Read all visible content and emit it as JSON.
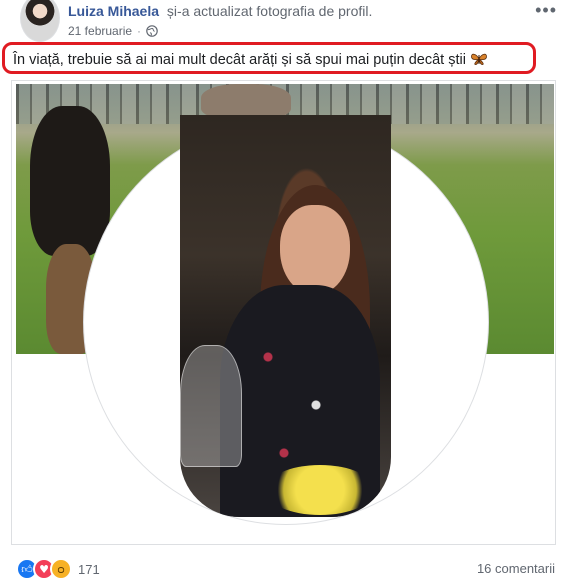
{
  "post": {
    "author": "Luiza Mihaela",
    "action": "și-a actualizat fotografia de profil.",
    "date": "21 februarie",
    "separator": "·",
    "caption": "În viață, trebuie să ai mai mult decât arăți și să spui mai puțin decât știi",
    "caption_highlight_color": "#e01b22"
  },
  "icons": {
    "privacy": "globe-icon",
    "more": "more-options-icon",
    "caption_emoji": "butterfly-icon"
  },
  "reactions": {
    "types": [
      "like",
      "love",
      "wow"
    ],
    "count": "171"
  },
  "comments": {
    "label": "16 comentarii"
  },
  "colors": {
    "link": "#385898",
    "secondary_text": "#616770",
    "like": "#1877f2",
    "love": "#f33e58",
    "wow": "#f7b125"
  }
}
